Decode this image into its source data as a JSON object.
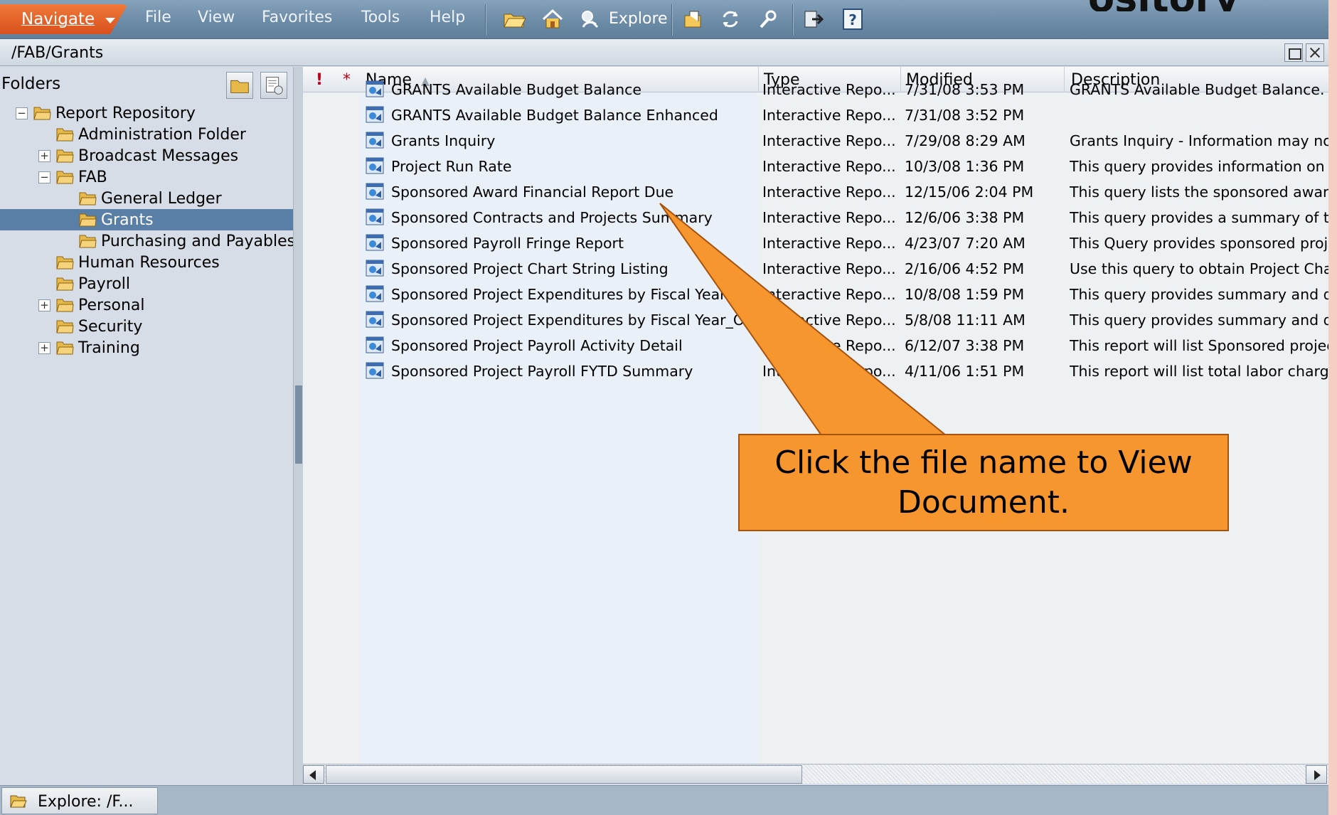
{
  "header_title_fragment": "ository",
  "menubar": {
    "navigate": "Navigate",
    "file": "File",
    "view": "View",
    "favorites": "Favorites",
    "tools": "Tools",
    "help": "Help",
    "explore": "Explore",
    "icons": [
      "open-folder-icon",
      "home-icon",
      "explore-icon",
      "publish-icon",
      "refresh-icon",
      "search-icon",
      "logoff-icon",
      "help-icon"
    ]
  },
  "path": "/FAB/Grants",
  "folders": {
    "title": "Folders",
    "tree": [
      {
        "label": "Report Repository",
        "level": 0,
        "toggle": "−"
      },
      {
        "label": "Administration Folder",
        "level": 1,
        "toggle": ""
      },
      {
        "label": "Broadcast Messages",
        "level": 1,
        "toggle": "+"
      },
      {
        "label": "FAB",
        "level": 1,
        "toggle": "−"
      },
      {
        "label": "General Ledger",
        "level": 2,
        "toggle": ""
      },
      {
        "label": "Grants",
        "level": 2,
        "toggle": "",
        "selected": true
      },
      {
        "label": "Purchasing and Payables",
        "level": 2,
        "toggle": ""
      },
      {
        "label": "Human Resources",
        "level": 1,
        "toggle": ""
      },
      {
        "label": "Payroll",
        "level": 1,
        "toggle": ""
      },
      {
        "label": "Personal",
        "level": 1,
        "toggle": "+"
      },
      {
        "label": "Security",
        "level": 1,
        "toggle": ""
      },
      {
        "label": "Training",
        "level": 1,
        "toggle": "+"
      }
    ]
  },
  "list": {
    "columns": {
      "priority": "!",
      "new": "*",
      "name": "Name",
      "type": "Type",
      "modified": "Modified",
      "description": "Description"
    },
    "sort_indicator": "▲",
    "rows": [
      {
        "name": "GRANTS Available Budget Balance",
        "type": "Interactive Repo...",
        "modified": "7/31/08 3:53 PM",
        "description": "GRANTS Available Budget Balance.  Se"
      },
      {
        "name": "GRANTS Available Budget Balance Enhanced",
        "type": "Interactive Repo...",
        "modified": "7/31/08 3:52 PM",
        "description": ""
      },
      {
        "name": "Grants Inquiry",
        "type": "Interactive Repo...",
        "modified": "7/29/08 8:29 AM",
        "description": "Grants Inquiry - Information may now"
      },
      {
        "name": "Project Run Rate",
        "type": "Interactive Repo...",
        "modified": "10/3/08 1:36 PM",
        "description": "This query provides information on fina"
      },
      {
        "name": "Sponsored Award Financial Report Due",
        "type": "Interactive Repo...",
        "modified": "12/15/06 2:04 PM",
        "description": "This query lists the sponsored awards"
      },
      {
        "name": "Sponsored Contracts and Projects Summary",
        "type": "Interactive Repo...",
        "modified": "12/6/06 3:38 PM",
        "description": "This query provides a summary of the"
      },
      {
        "name": "Sponsored Payroll Fringe Report",
        "type": "Interactive Repo...",
        "modified": "4/23/07 7:20 AM",
        "description": "This Query provides sponsored project"
      },
      {
        "name": "Sponsored Project Chart String Listing",
        "type": "Interactive Repo...",
        "modified": "2/16/06 4:52 PM",
        "description": "Use this query to obtain Project Charts"
      },
      {
        "name": "Sponsored Project Expenditures by Fiscal Year",
        "type": "Interactive Repo...",
        "modified": "10/8/08 1:59 PM",
        "description": "This query provides summary and deta"
      },
      {
        "name": "Sponsored Project Expenditures by Fiscal Year_OLD",
        "type": "Interactive Repo...",
        "modified": "5/8/08 11:11 AM",
        "description": "This query provides summary and deta"
      },
      {
        "name": "Sponsored Project Payroll Activity Detail",
        "type": "Interactive Repo...",
        "modified": "6/12/07 3:38 PM",
        "description": "This report will list Sponsored project F"
      },
      {
        "name": "Sponsored Project Payroll FYTD Summary",
        "type": "Interactive Repo...",
        "modified": "4/11/06 1:51 PM",
        "description": "This report will list total labor charges a"
      }
    ]
  },
  "statusbar": {
    "task": "Explore: /F..."
  },
  "callout": {
    "text": "Click the file name to View Document.",
    "color": "#f7952e"
  },
  "colors": {
    "navigate": "#e0602a",
    "selection": "#5a7fa6",
    "menubar": "#6f8eaa"
  }
}
